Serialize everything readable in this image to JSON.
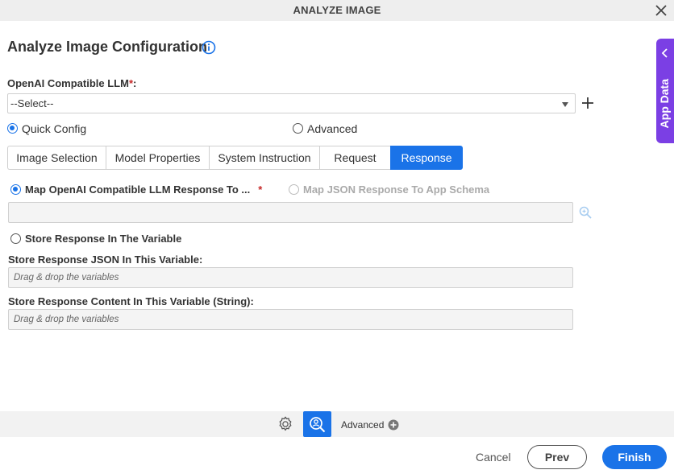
{
  "window": {
    "title": "ANALYZE IMAGE",
    "close_icon": "close-icon"
  },
  "heading": {
    "title": "Analyze Image Configuration",
    "info_icon": "info-icon"
  },
  "side_panel": {
    "label": "App Data",
    "icon": "chevron-left-icon",
    "color": "#7b3fe4"
  },
  "llm": {
    "label": "OpenAI Compatible LLM",
    "required_mark": "*",
    "colon": ":",
    "selected": "--Select--",
    "add_icon": "plus-icon"
  },
  "config_mode": {
    "options": [
      {
        "label": "Quick Config",
        "selected": true
      },
      {
        "label": "Advanced",
        "selected": false
      }
    ]
  },
  "tabs": [
    {
      "label": "Image Selection",
      "active": false
    },
    {
      "label": "Model Properties",
      "active": false
    },
    {
      "label": "System Instruction",
      "active": false
    },
    {
      "label": "Request",
      "active": false
    },
    {
      "label": "Response",
      "active": true
    }
  ],
  "response": {
    "map_llm_label": "Map OpenAI Compatible LLM Response To ...",
    "map_llm_required": "*",
    "map_json_label": "Map JSON Response To App Schema",
    "map_value": "",
    "store_variable_label": "Store Response In The Variable",
    "json_var_label": "Store Response JSON In This Variable:",
    "json_var_placeholder": "Drag & drop the variables",
    "content_var_label": "Store Response Content In This Variable (String):",
    "content_var_placeholder": "Drag & drop the variables"
  },
  "toolbar": {
    "gear_icon": "gear-icon",
    "test_icon": "test-search-icon",
    "advanced_label": "Advanced",
    "advanced_icon": "plus-circle-icon"
  },
  "footer": {
    "cancel": "Cancel",
    "prev": "Prev",
    "finish": "Finish"
  },
  "colors": {
    "accent": "#1a73e8",
    "required": "#c62828"
  }
}
